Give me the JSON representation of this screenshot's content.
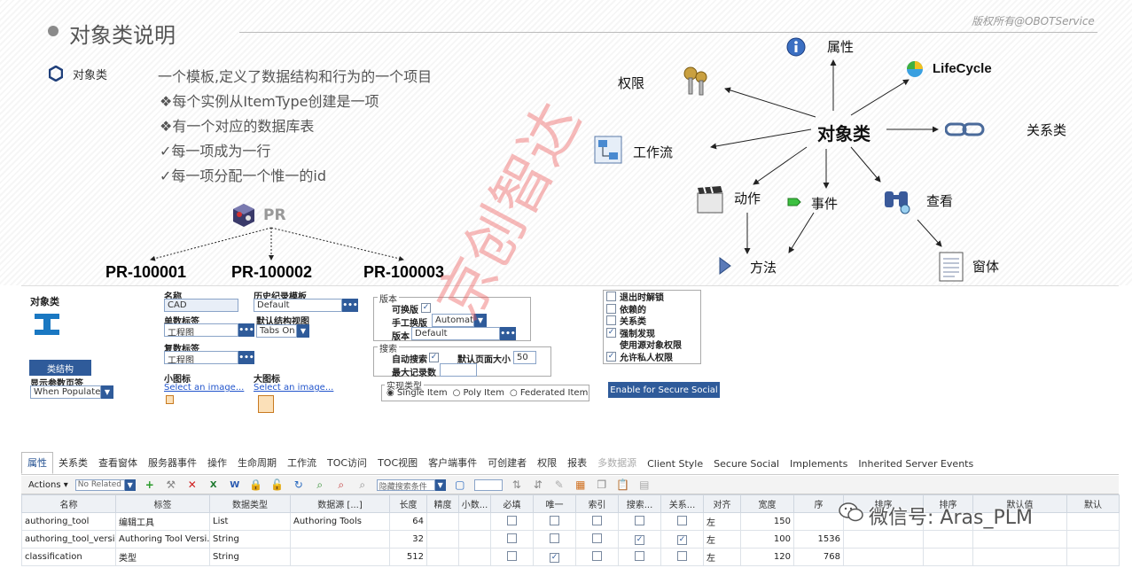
{
  "slide": {
    "title": "对象类说明",
    "copyright": "版权所有@OBOTService",
    "section_label": "对象类",
    "lines": [
      "一个模板,定义了数据结构和行为的一个项目",
      "❖每个实例从ItemType创建是一项",
      "❖有一个对应的数据库表",
      "✓每一项成为一行",
      "✓每一项分配一个惟一的id"
    ],
    "pr_label": "PR",
    "pr_items": [
      "PR-100001",
      "PR-100002",
      "PR-100003"
    ],
    "diagram": {
      "center": "对象类",
      "nodes": {
        "properties": "属性",
        "permissions": "权限",
        "lifecycle": "LifeCycle",
        "workflow": "工作流",
        "relationships": "关系类",
        "actions": "动作",
        "events": "事件",
        "views": "查看",
        "methods": "方法",
        "forms": "窗体"
      }
    },
    "watermark": "京创智达"
  },
  "form": {
    "itemtype_label": "对象类",
    "struct_button": "类结构",
    "show_params_label": "显示参数页签",
    "show_params_value": "When Populated",
    "name_label": "名称",
    "name_value": "CAD",
    "history_label": "历史纪录模板",
    "history_value": "Default",
    "singular_label": "单数标签",
    "singular_value": "工程图",
    "default_view_label": "默认结构视图",
    "default_view_value": "Tabs On",
    "plural_label": "复数标签",
    "plural_value": "工程图",
    "small_icon_label": "小图标",
    "small_icon_link": "Select an image...",
    "large_icon_label": "大图标",
    "large_icon_link": "Select an image...",
    "version_legend": "版本",
    "versionable_label": "可换版",
    "manual_version_label": "手工换版",
    "manual_version_value": "Automatic",
    "version_label": "版本",
    "version_value": "Default",
    "search_legend": "搜索",
    "auto_search_label": "自动搜索",
    "page_size_label": "默认页面大小",
    "page_size_value": "50",
    "max_records_label": "最大记录数",
    "max_records_value": "",
    "impl_legend": "实现类型",
    "impl_options": [
      "Single Item",
      "Poly Item",
      "Federated Item"
    ],
    "checkboxes": [
      {
        "label": "退出时解锁",
        "checked": false
      },
      {
        "label": "依赖的",
        "checked": false
      },
      {
        "label": "关系类",
        "checked": false
      },
      {
        "label": "强制发现",
        "checked": true
      },
      {
        "label": "使用源对象权限",
        "checked": false
      },
      {
        "label": "允许私人权限",
        "checked": true
      }
    ],
    "secure_social_button": "Enable for Secure Social"
  },
  "tabs": [
    "属性",
    "关系类",
    "查看窗体",
    "服务器事件",
    "操作",
    "生命周期",
    "工作流",
    "TOC访问",
    "TOC视图",
    "客户端事件",
    "可创建者",
    "权限",
    "报表",
    "多数据源",
    "Client Style",
    "Secure Social",
    "Implements",
    "Inherited Server Events"
  ],
  "toolbar": {
    "actions_label": "Actions",
    "related_value": "No Related",
    "search_mode": "隐藏搜索条件"
  },
  "grid": {
    "headers": [
      "名称",
      "标签",
      "数据类型",
      "数据源 [...]",
      "长度",
      "精度",
      "小数...",
      "必填",
      "唯一",
      "索引",
      "搜索...",
      "关系...",
      "对齐",
      "宽度",
      "序",
      "排序",
      "排序",
      "默认值",
      "默认"
    ],
    "rows": [
      [
        "authoring_tool",
        "编辑工具",
        "List",
        "Authoring Tools",
        "64",
        "",
        "",
        false,
        false,
        false,
        false,
        false,
        "左",
        "150",
        "",
        "",
        "",
        "",
        ""
      ],
      [
        "authoring_tool_versi...",
        "Authoring Tool Versi...",
        "String",
        "",
        "32",
        "",
        "",
        false,
        false,
        false,
        true,
        true,
        "左",
        "100",
        "1536",
        "",
        "",
        "",
        ""
      ],
      [
        "classification",
        "类型",
        "String",
        "",
        "512",
        "",
        "",
        false,
        true,
        false,
        false,
        false,
        "左",
        "120",
        "768",
        "",
        "",
        "",
        ""
      ]
    ]
  },
  "wechat_watermark": "微信号: Aras_PLM"
}
